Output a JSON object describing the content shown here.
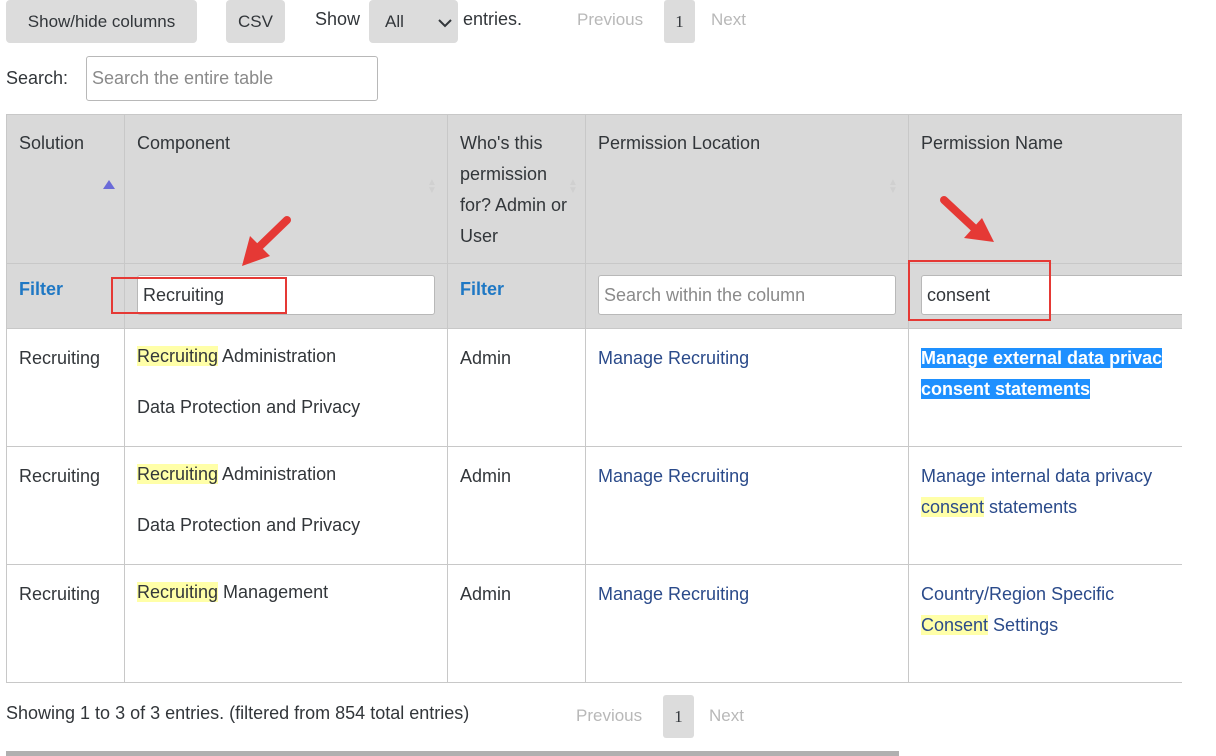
{
  "toolbar": {
    "show_hide_label": "Show/hide columns",
    "csv_label": "CSV",
    "show_label": "Show",
    "entries_select_value": "All",
    "entries_label": "entries."
  },
  "pagination": {
    "previous": "Previous",
    "page": "1",
    "next": "Next"
  },
  "search": {
    "label": "Search:",
    "placeholder": "Search the entire table"
  },
  "table": {
    "headers": {
      "solution": "Solution",
      "component": "Component",
      "who": "Who's this permission for? Admin or User",
      "location": "Permission Location",
      "name": "Permission Name"
    },
    "filters": {
      "solution_link": "Filter",
      "component_value": "Recruiting",
      "who_link": "Filter",
      "location_placeholder": "Search within the column",
      "name_value": "consent"
    },
    "rows": [
      {
        "solution": "Recruiting",
        "component_hl": "Recruiting",
        "component_rest": " Administration",
        "component_line2": "Data Protection and Privacy",
        "who": "Admin",
        "location": "Manage Recruiting",
        "name_line1": "Manage external data privac",
        "name_line2": "consent statements"
      },
      {
        "solution": "Recruiting",
        "component_hl": "Recruiting",
        "component_rest": " Administration",
        "component_line2": "Data Protection and Privacy",
        "who": "Admin",
        "location": "Manage Recruiting",
        "name_line1": "Manage internal data privacy",
        "name_hl": "consent",
        "name_rest": " statements"
      },
      {
        "solution": "Recruiting",
        "component_hl": "Recruiting",
        "component_rest": " Management",
        "who": "Admin",
        "location": "Manage Recruiting",
        "name_line1": "Country/Region Specific",
        "name_hl": "Consent",
        "name_rest": " Settings"
      }
    ]
  },
  "footer": {
    "info": "Showing 1 to 3 of 3 entries. (filtered from 854 total entries)"
  },
  "colors": {
    "annotation_red": "#e53935",
    "highlight_yellow": "#ffffa8",
    "selection_blue": "#1e90ff",
    "filter_link_blue": "#1f78c4"
  }
}
